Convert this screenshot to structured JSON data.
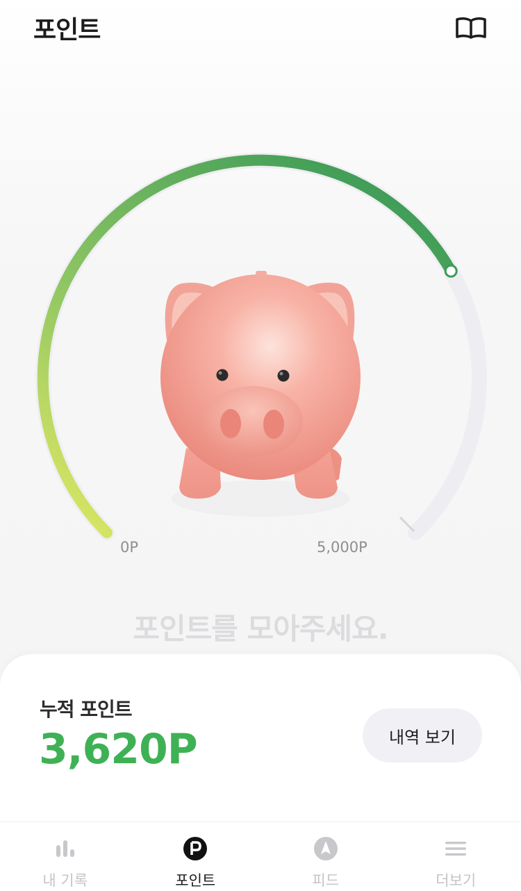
{
  "header": {
    "title": "포인트",
    "guide_icon": "book-open-icon"
  },
  "gauge": {
    "min_label": "0P",
    "max_label": "5,000P",
    "min_value": 0,
    "max_value": 5000,
    "current_value": 3620,
    "image": "piggy-bank-illustration",
    "colors": {
      "start": "#e2ea63",
      "end": "#3b9a57",
      "track": "#eeeef2"
    }
  },
  "prompt_text": "포인트를 모아주세요.",
  "summary": {
    "label": "누적 포인트",
    "value": "3,620P",
    "history_button": "내역 보기",
    "value_color": "#3fb155"
  },
  "tabbar": {
    "tabs": [
      {
        "label": "내 기록",
        "icon": "bar-chart-icon",
        "active": false
      },
      {
        "label": "포인트",
        "icon": "point-coin-icon",
        "active": true
      },
      {
        "label": "피드",
        "icon": "compass-icon",
        "active": false
      },
      {
        "label": "더보기",
        "icon": "menu-icon",
        "active": false
      }
    ]
  }
}
